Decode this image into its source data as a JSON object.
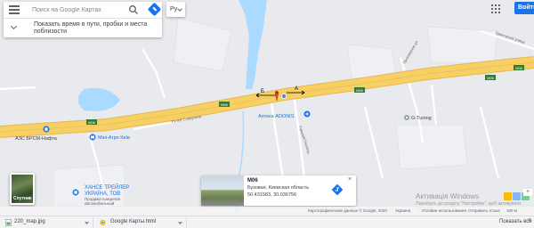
{
  "search": {
    "placeholder": "Поиск на Google Картах",
    "traffic_toggle": "Показать время в пути, пробки и места поблизости"
  },
  "language": {
    "selected": "Ру"
  },
  "header": {
    "signin_label": "Войти"
  },
  "map": {
    "places": {
      "azs": "АЗС БРСМ-Нафта",
      "agro": "Міні-Агро Київ",
      "trailer_line1": "ХАНСЕ ТРЕЙЛЕР",
      "trailer_line2": "УКРАЇНА, ТОВ",
      "trailer_sub1": "Продажа прицепов",
      "trailer_sub2": "автомобильный",
      "pharmacy": "Аптека ADONIS",
      "tuning": "G-Tuning"
    },
    "streets": {
      "slavutich": "Ручей Славутича",
      "gorky": "Горький Гнилець",
      "priozernaya": "Приозерная ул.",
      "top_right": "Тракторная улица"
    },
    "road_shields": [
      "M06",
      "M06",
      "M06",
      "M06",
      "M06"
    ],
    "markers": {
      "b": "Б",
      "a": "А"
    }
  },
  "layer_thumbnail": {
    "label": "Спутник"
  },
  "info_card": {
    "title": "M06",
    "subtitle": "Бузовая, Киевская область",
    "coords": "50.431583, 30.036756"
  },
  "footer": {
    "map_data": "Картографические данные © Google, 2020",
    "country": "Украина",
    "terms": "Условия использования",
    "feedback": "Отправить отзыв",
    "scale": "100 м"
  },
  "watermark": {
    "title": "Активація Windows",
    "subtitle": "Перейдіть до розділу \"Настройки\", щоб активувати Windows."
  },
  "downloads": {
    "items": [
      {
        "name": "220_map.jpg"
      },
      {
        "name": "Google Карты.html"
      }
    ],
    "show_all_label": "Показать все"
  },
  "colors": {
    "highway": "#f6cf65",
    "water": "#aadaff",
    "background": "#e8eaed",
    "accent": "#1a73e8",
    "pin": "#ea4335"
  }
}
